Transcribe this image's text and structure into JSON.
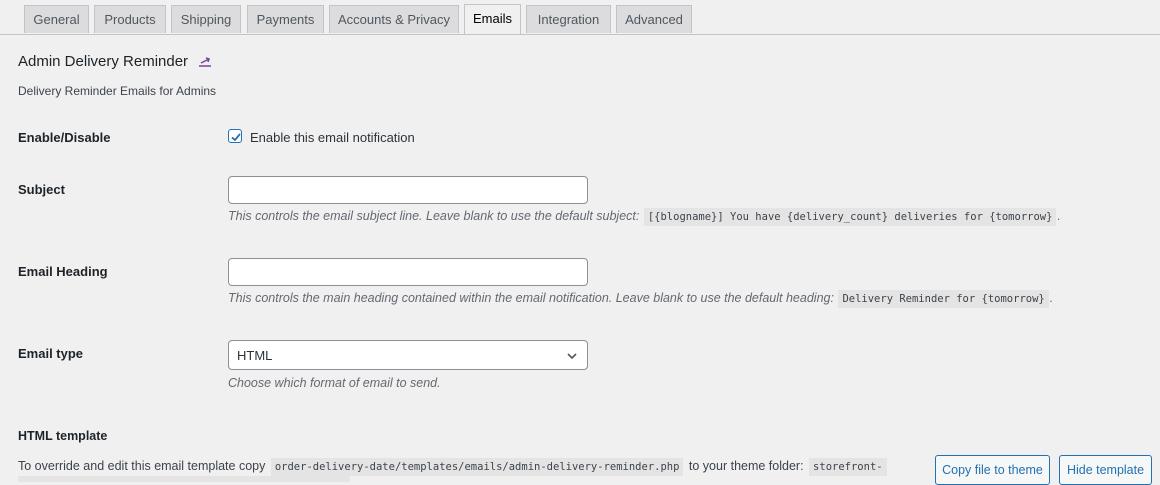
{
  "tabs": [
    {
      "label": "General"
    },
    {
      "label": "Products"
    },
    {
      "label": "Shipping"
    },
    {
      "label": "Payments"
    },
    {
      "label": "Accounts & Privacy"
    },
    {
      "label": "Emails",
      "active": true
    },
    {
      "label": "Integration"
    },
    {
      "label": "Advanced"
    }
  ],
  "section": {
    "title": "Admin Delivery Reminder",
    "description": "Delivery Reminder Emails for Admins"
  },
  "fields": {
    "enable": {
      "label": "Enable/Disable",
      "checkbox_label": "Enable this email notification",
      "checked": true
    },
    "subject": {
      "label": "Subject",
      "value": "",
      "desc_prefix": "This controls the email subject line. Leave blank to use the default subject:",
      "desc_code": "[{blogname}] You have {delivery_count} deliveries for {tomorrow}",
      "desc_suffix": "."
    },
    "heading": {
      "label": "Email Heading",
      "value": "",
      "desc_prefix": "This controls the main heading contained within the email notification. Leave blank to use the default heading:",
      "desc_code": "Delivery Reminder for {tomorrow}",
      "desc_suffix": "."
    },
    "email_type": {
      "label": "Email type",
      "selected": "HTML",
      "desc": "Choose which format of email to send."
    }
  },
  "template": {
    "heading": "HTML template",
    "text_prefix": "To override and edit this email template copy",
    "path": "order-delivery-date/templates/emails/admin-delivery-reminder.php",
    "text_middle": "to your theme folder:",
    "theme_folder": "storefront-",
    "copy_button": "Copy file to theme",
    "hide_button": "Hide template"
  },
  "colors": {
    "accent": "#2271b1",
    "background": "#f0f0f1",
    "up_icon": "#7b3fa0"
  },
  "icons": {
    "title_link": "up-arrow-icon",
    "checkbox": "checkmark-icon",
    "select": "chevron-down-icon"
  }
}
